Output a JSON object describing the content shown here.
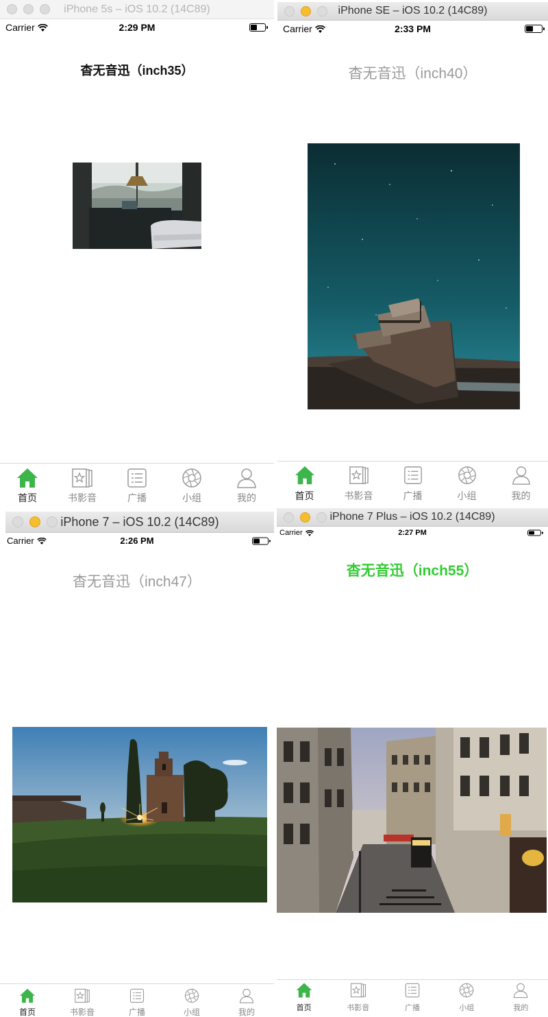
{
  "screens": [
    {
      "window_title": "iPhone 5s – iOS 10.2 (14C89)",
      "status": {
        "carrier": "Carrier",
        "time": "2:29 PM"
      },
      "heading": "杳无音迅（inch35）",
      "heading_color": "#111111",
      "image_icon": "desk-window-photo"
    },
    {
      "window_title": "iPhone SE – iOS 10.2 (14C89)",
      "status": {
        "carrier": "Carrier",
        "time": "2:33 PM"
      },
      "heading": "杳无音迅（inch40）",
      "heading_color": "#9a9a9a",
      "image_icon": "stranded-boat-photo"
    },
    {
      "window_title": "iPhone 7 – iOS 10.2 (14C89)",
      "status": {
        "carrier": "Carrier",
        "time": "2:26 PM"
      },
      "heading": "杳无音迅（inch47）",
      "heading_color": "#9a9a9a",
      "image_icon": "tuscany-chapel-photo"
    },
    {
      "window_title": "iPhone 7 Plus – iOS 10.2 (14C89)",
      "status": {
        "carrier": "Carrier",
        "time": "2:27 PM"
      },
      "heading": "杳无音迅（inch55）",
      "heading_color": "#33cc33",
      "image_icon": "paris-street-photo"
    }
  ],
  "tabs": [
    {
      "label": "首页",
      "icon": "home-icon",
      "active": true
    },
    {
      "label": "书影音",
      "icon": "star-books-icon",
      "active": false
    },
    {
      "label": "广播",
      "icon": "list-card-icon",
      "active": false
    },
    {
      "label": "小组",
      "icon": "compass-icon",
      "active": false
    },
    {
      "label": "我的",
      "icon": "person-icon",
      "active": false
    }
  ],
  "colors": {
    "accent_green": "#3cb54a",
    "tab_gray": "#888888"
  }
}
